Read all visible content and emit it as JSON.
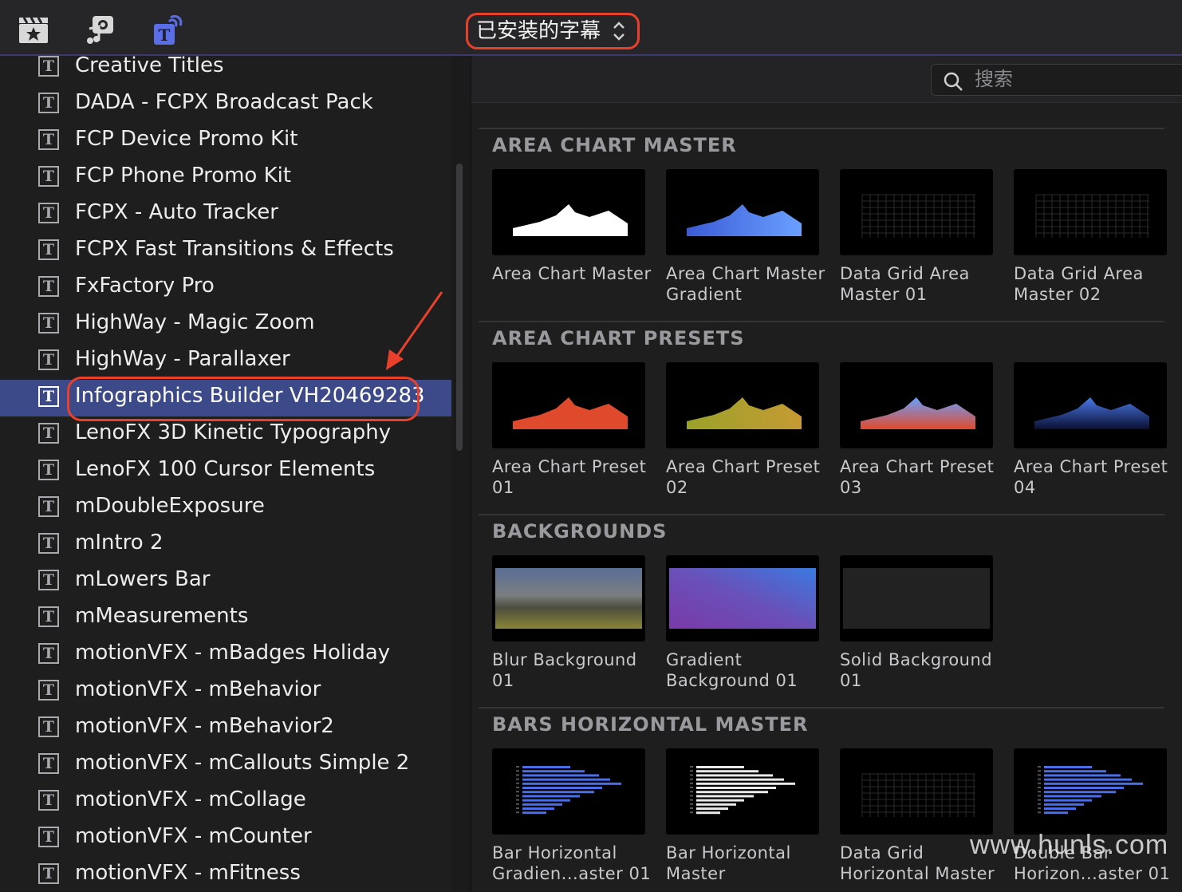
{
  "toolbar": {
    "icons": [
      "clapper-star-icon",
      "music-camera-icon",
      "titles-icon"
    ],
    "selector_label": "已安装的字幕",
    "selector_chevron": "⌃⌄"
  },
  "sidebar": {
    "items": [
      {
        "label": "Creative Titles"
      },
      {
        "label": "DADA - FCPX Broadcast Pack"
      },
      {
        "label": "FCP Device Promo Kit"
      },
      {
        "label": "FCP Phone Promo Kit"
      },
      {
        "label": "FCPX - Auto Tracker"
      },
      {
        "label": "FCPX Fast Transitions & Effects"
      },
      {
        "label": "FxFactory Pro"
      },
      {
        "label": "HighWay - Magic Zoom"
      },
      {
        "label": "HighWay - Parallaxer"
      },
      {
        "label": "Infographics Builder VH20469283",
        "selected": true
      },
      {
        "label": "LenoFX 3D Kinetic Typography"
      },
      {
        "label": "LenoFX 100 Cursor Elements"
      },
      {
        "label": "mDoubleExposure"
      },
      {
        "label": "mIntro 2"
      },
      {
        "label": "mLowers Bar"
      },
      {
        "label": "mMeasurements"
      },
      {
        "label": "motionVFX - mBadges Holiday"
      },
      {
        "label": "motionVFX - mBehavior"
      },
      {
        "label": "motionVFX - mBehavior2"
      },
      {
        "label": "motionVFX - mCallouts Simple 2"
      },
      {
        "label": "motionVFX - mCollage"
      },
      {
        "label": "motionVFX - mCounter"
      },
      {
        "label": "motionVFX - mFitness"
      }
    ],
    "item_icon_glyph": "T"
  },
  "search": {
    "placeholder": "搜索"
  },
  "sections": [
    {
      "title": "AREA CHART MASTER",
      "tiles": [
        {
          "line1": "Area Chart Master",
          "line2": "",
          "thumb": "area-white"
        },
        {
          "line1": "Area Chart Master",
          "line2": "Gradient",
          "thumb": "area-blue"
        },
        {
          "line1": "Data Grid Area",
          "line2": "Master 01",
          "thumb": "grid"
        },
        {
          "line1": "Data Grid Area",
          "line2": "Master 02",
          "thumb": "grid"
        }
      ]
    },
    {
      "title": "AREA CHART PRESETS",
      "tiles": [
        {
          "line1": "Area Chart Preset",
          "line2": "01",
          "thumb": "area-red"
        },
        {
          "line1": "Area Chart Preset",
          "line2": "02",
          "thumb": "area-olive"
        },
        {
          "line1": "Area Chart Preset",
          "line2": "03",
          "thumb": "area-redblue"
        },
        {
          "line1": "Area Chart Preset",
          "line2": "04",
          "thumb": "area-darkblue"
        }
      ]
    },
    {
      "title": "BACKGROUNDS",
      "tiles": [
        {
          "line1": "Blur Background",
          "line2": "01",
          "thumb": "blur-landscape"
        },
        {
          "line1": "Gradient",
          "line2": "Background 01",
          "thumb": "purple-gradient"
        },
        {
          "line1": "Solid Background",
          "line2": "01",
          "thumb": "solid-dark"
        }
      ]
    },
    {
      "title": "BARS HORIZONTAL MASTER",
      "tiles": [
        {
          "line1": "Bar Horizontal",
          "line2": "Gradien...aster 01",
          "thumb": "bars-blue"
        },
        {
          "line1": "Bar Horizontal",
          "line2": "Master",
          "thumb": "bars-white"
        },
        {
          "line1": "Data Grid",
          "line2": "Horizontal Master",
          "thumb": "grid"
        },
        {
          "line1": "Double Bar",
          "line2": "Horizon...aster 01",
          "thumb": "bars-blue"
        }
      ]
    }
  ],
  "watermark": "www.hunls.com",
  "colors": {
    "accent_selection": "#3d4a8a",
    "annotation_red": "#e8402a",
    "title_icon_blue": "#5a6ee8"
  }
}
